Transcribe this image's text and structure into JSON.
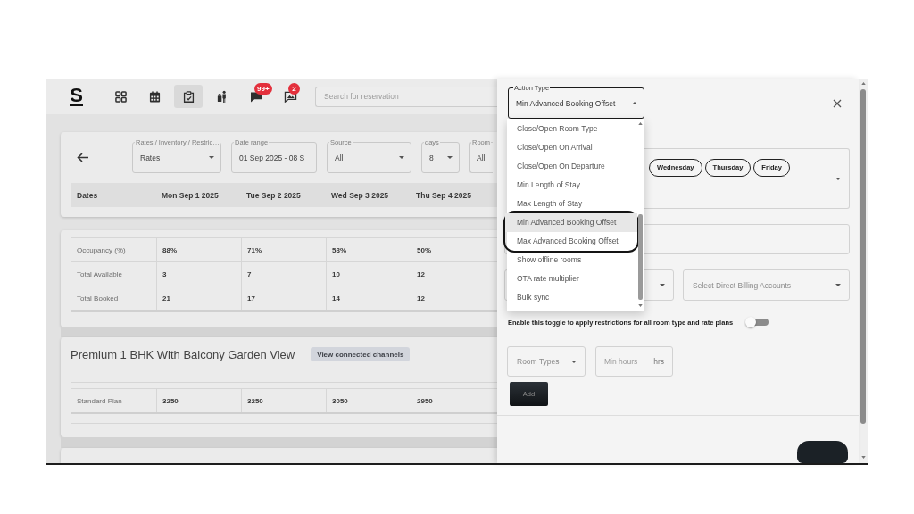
{
  "top_bar": {
    "logo": "S",
    "nav": [
      {
        "kind": "dashboard",
        "selected": false
      },
      {
        "kind": "calendar",
        "selected": false
      },
      {
        "kind": "clipboard",
        "selected": true
      },
      {
        "kind": "luggage",
        "selected": false
      },
      {
        "kind": "chat",
        "selected": false,
        "badge": "99+"
      },
      {
        "kind": "image_chat",
        "selected": false,
        "badge": "2"
      }
    ],
    "search": {
      "placeholder": "Search for reservation"
    }
  },
  "filters": [
    {
      "kind": "select",
      "label": "Rates / Inventory / Restric…",
      "value": "Rates"
    },
    {
      "kind": "date",
      "label": "Date range",
      "value": "01 Sep 2025 - 08 S"
    },
    {
      "kind": "select",
      "label": "Source",
      "value": "All"
    },
    {
      "kind": "select",
      "label": "days",
      "value": "8"
    },
    {
      "kind": "partial",
      "label": "Room",
      "value": "All"
    }
  ],
  "dates_table": {
    "columns": [
      "Dates",
      "Mon Sep 1 2025",
      "Tue Sep 2 2025",
      "Wed Sep 3 2025",
      "Thu Sep 4 2025"
    ]
  },
  "summary_table": {
    "rows": [
      {
        "label": "Occupancy (%)",
        "values": [
          "88%",
          "71%",
          "58%",
          "50%"
        ]
      },
      {
        "label": "Total Available",
        "values": [
          "3",
          "7",
          "10",
          "12"
        ]
      },
      {
        "label": "Total Booked",
        "values": [
          "21",
          "17",
          "14",
          "12"
        ]
      }
    ]
  },
  "room_sections": [
    {
      "title": "Premium 1 BHK With Balcony Garden View",
      "button": "View connected channels",
      "rows": [
        {
          "label": "Standard Plan",
          "values": [
            "3250",
            "3250",
            "3050",
            "2950"
          ]
        }
      ]
    }
  ],
  "drawer": {
    "action_type": {
      "label": "Action Type",
      "value": "Min Advanced Booking Offset",
      "expanded": true,
      "options": [
        {
          "label": "Close/Open Room Type",
          "selected": false,
          "circled": false
        },
        {
          "label": "Close/Open On Arrival",
          "selected": false,
          "circled": false
        },
        {
          "label": "Close/Open On Departure",
          "selected": false,
          "circled": false
        },
        {
          "label": "Min Length of Stay",
          "selected": false,
          "circled": false
        },
        {
          "label": "Max Length of Stay",
          "selected": false,
          "circled": false
        },
        {
          "label": "Min Advanced Booking Offset",
          "selected": true,
          "circled": true
        },
        {
          "label": "Max Advanced Booking Offset",
          "selected": false,
          "circled": true
        },
        {
          "label": "Show offline rooms",
          "selected": false,
          "circled": false
        },
        {
          "label": "OTA rate multiplier",
          "selected": false,
          "circled": false
        },
        {
          "label": "Bulk sync",
          "selected": false,
          "circled": false
        }
      ]
    },
    "day_chips": [
      "Wednesday",
      "Thursday",
      "Friday"
    ],
    "billing": {
      "placeholder": "Select Direct Billing Accounts"
    },
    "toggle": {
      "label": "Enable this toggle to apply restrictions for all room type and rate plans",
      "on": false
    },
    "room_types": {
      "placeholder": "Room Types"
    },
    "min_hours": {
      "placeholder": "Min hours",
      "suffix": "hrs"
    },
    "add_button": "Add"
  }
}
